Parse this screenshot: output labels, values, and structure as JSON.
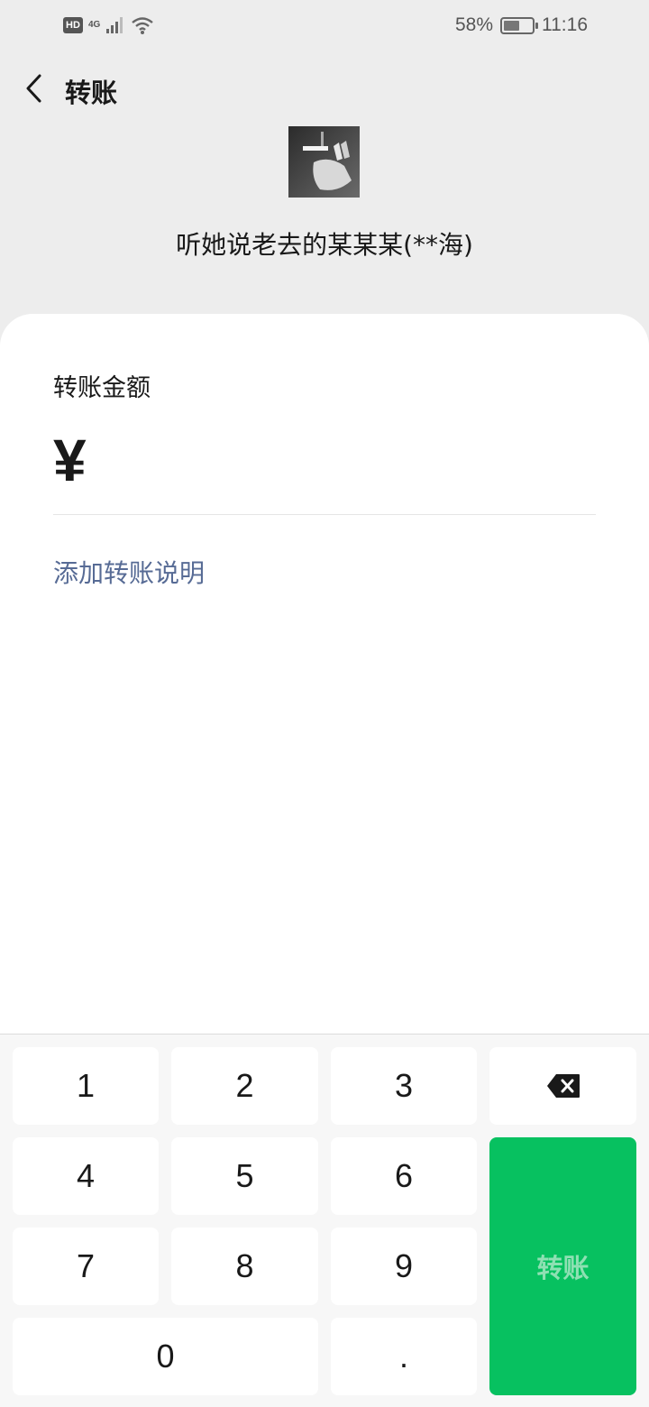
{
  "status_bar": {
    "hd": "HD",
    "network": "4G",
    "battery_percent": "58%",
    "battery_level": 0.58,
    "time": "11:16"
  },
  "header": {
    "title": "转账",
    "back_icon": "chevron-left-icon"
  },
  "recipient": {
    "name": "听她说老去的某某某(**海)"
  },
  "form": {
    "amount_label": "转账金额",
    "currency_symbol": "¥",
    "amount_value": "",
    "add_note": "添加转账说明"
  },
  "keypad": {
    "keys": [
      "1",
      "2",
      "3",
      "4",
      "5",
      "6",
      "7",
      "8",
      "9",
      "0",
      "."
    ],
    "delete_icon": "backspace-icon",
    "confirm_label": "转账",
    "confirm_color": "#07c160",
    "confirm_text_color": "#8ee0b3"
  },
  "colors": {
    "background": "#ededed",
    "card": "#ffffff",
    "link": "#576b95"
  }
}
